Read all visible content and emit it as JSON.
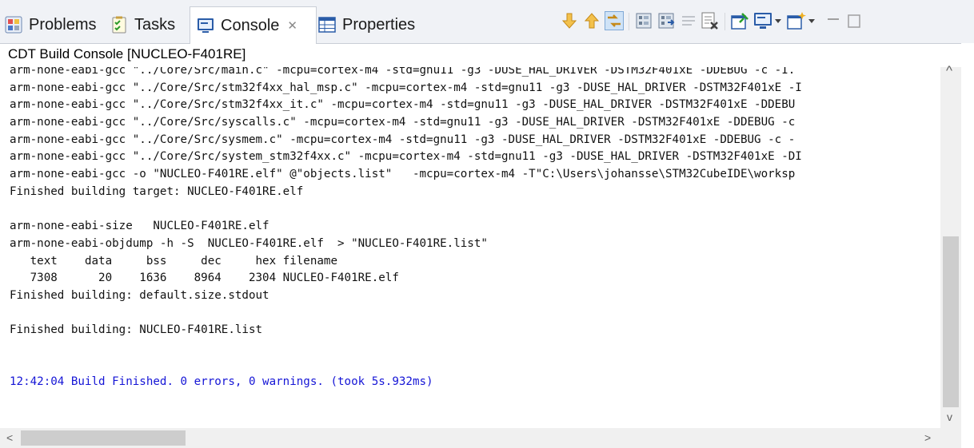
{
  "tabs": [
    {
      "label": "Problems",
      "icon": "problems-icon"
    },
    {
      "label": "Tasks",
      "icon": "tasks-icon"
    },
    {
      "label": "Console",
      "icon": "console-icon",
      "active": true,
      "close": "✕"
    },
    {
      "label": "Properties",
      "icon": "properties-icon"
    }
  ],
  "toolbar": {
    "icons": [
      "scroll-down-icon",
      "scroll-up-icon",
      "scroll-lock-icon",
      "copy-build-log-icon",
      "open-build-log-icon",
      "word-wrap-icon",
      "clear-console-icon",
      "pin-console-icon",
      "display-console-icon",
      "open-console-icon",
      "minimize-icon",
      "maximize-icon"
    ]
  },
  "console": {
    "title": "CDT Build Console [NUCLEO-F401RE]",
    "lines": [
      "arm-none-eabi-gcc \"../Core/Src/main.c\" -mcpu=cortex-m4 -std=gnu11 -g3 -DUSE_HAL_DRIVER -DSTM32F401xE -DDEBUG -c -I.",
      "arm-none-eabi-gcc \"../Core/Src/stm32f4xx_hal_msp.c\" -mcpu=cortex-m4 -std=gnu11 -g3 -DUSE_HAL_DRIVER -DSTM32F401xE -I",
      "arm-none-eabi-gcc \"../Core/Src/stm32f4xx_it.c\" -mcpu=cortex-m4 -std=gnu11 -g3 -DUSE_HAL_DRIVER -DSTM32F401xE -DDEBU",
      "arm-none-eabi-gcc \"../Core/Src/syscalls.c\" -mcpu=cortex-m4 -std=gnu11 -g3 -DUSE_HAL_DRIVER -DSTM32F401xE -DDEBUG -c",
      "arm-none-eabi-gcc \"../Core/Src/sysmem.c\" -mcpu=cortex-m4 -std=gnu11 -g3 -DUSE_HAL_DRIVER -DSTM32F401xE -DDEBUG -c -",
      "arm-none-eabi-gcc \"../Core/Src/system_stm32f4xx.c\" -mcpu=cortex-m4 -std=gnu11 -g3 -DUSE_HAL_DRIVER -DSTM32F401xE -DI",
      "arm-none-eabi-gcc -o \"NUCLEO-F401RE.elf\" @\"objects.list\"   -mcpu=cortex-m4 -T\"C:\\Users\\johansse\\STM32CubeIDE\\worksp",
      "Finished building target: NUCLEO-F401RE.elf",
      "",
      "arm-none-eabi-size   NUCLEO-F401RE.elf",
      "arm-none-eabi-objdump -h -S  NUCLEO-F401RE.elf  > \"NUCLEO-F401RE.list\"",
      "   text    data     bss     dec     hex filename",
      "   7308      20    1636    8964    2304 NUCLEO-F401RE.elf",
      "Finished building: default.size.stdout",
      "",
      "Finished building: NUCLEO-F401RE.list",
      "",
      "",
      "12:42:04 Build Finished. 0 errors, 0 warnings. (took 5s.932ms)"
    ],
    "status_line_color": "#1515d6"
  },
  "scrollbars": {
    "vertical": {
      "up": "^",
      "down": "v"
    },
    "horizontal": {
      "left": "<",
      "right": ">"
    }
  }
}
